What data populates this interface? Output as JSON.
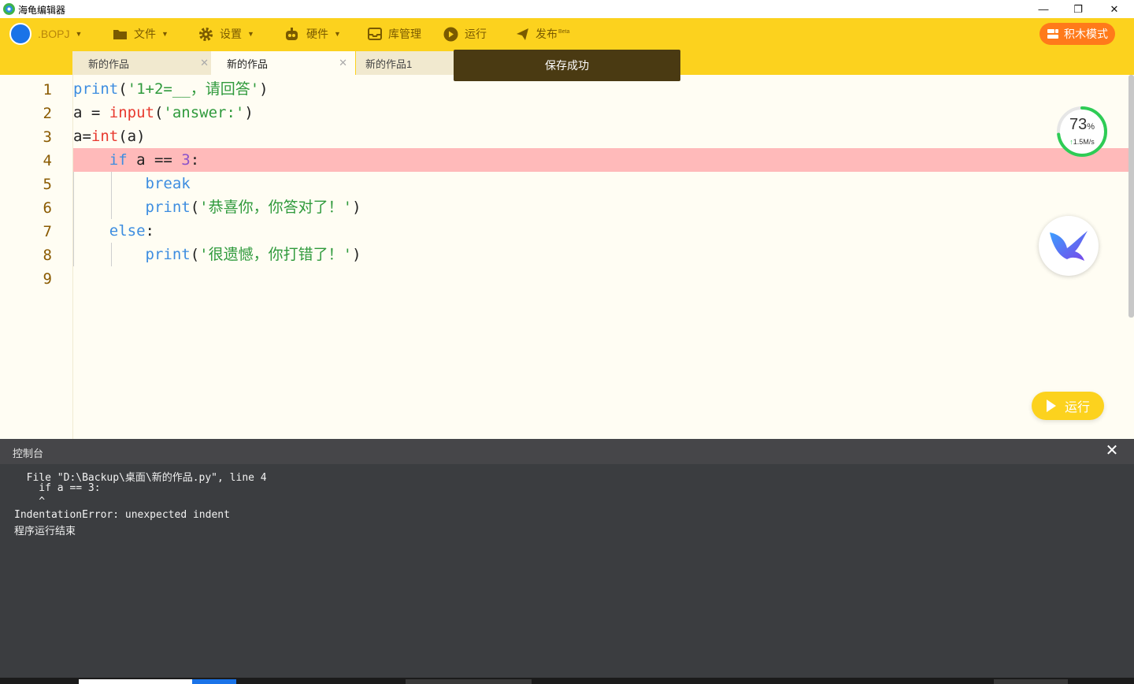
{
  "window": {
    "title": "海龟编辑器",
    "minimize_glyph": "—",
    "restore_glyph": "❐",
    "close_glyph": "✕"
  },
  "toolbar": {
    "user": ".BOPJ",
    "file": "文件",
    "settings": "设置",
    "hardware": "硬件",
    "library": "库管理",
    "run": "运行",
    "publish": "发布",
    "publish_badge": "Beta",
    "block_mode": "积木模式"
  },
  "tabs": [
    {
      "label": "新的作品",
      "active": false
    },
    {
      "label": "新的作品",
      "active": true
    },
    {
      "label": "新的作品1",
      "active": false
    }
  ],
  "tab_close_glyph": "✕",
  "toast": "保存成功",
  "editor": {
    "line_numbers": [
      "1",
      "2",
      "3",
      "4",
      "5",
      "6",
      "7",
      "8",
      "9"
    ],
    "highlighted_line": 4,
    "lines": [
      "print('1+2=__，请回答')",
      "a = input('answer:')",
      "a=int(a)",
      "    if a == 3:",
      "        break",
      "        print('恭喜你，你答对了！')",
      "    else:",
      "        print('很遗憾，你打错了！')",
      ""
    ]
  },
  "speed_widget": {
    "percent": "73",
    "percent_sign": "%",
    "speed": "1.5M/s",
    "ring_level": 0.73,
    "ring_color": "#2ecc55"
  },
  "run_button": "运行",
  "console": {
    "title": "控制台",
    "close_glyph": "✕",
    "lines": [
      "  File \"D:\\Backup\\桌面\\新的作品.py\", line 4",
      "    if a == 3:",
      "    ^",
      "IndentationError: unexpected indent",
      "程序运行结束"
    ]
  },
  "colors": {
    "toolbar_bg": "#fcd21e",
    "accent_orange": "#ff7a1a",
    "error_highlight": "#ffbaba",
    "console_bg": "#3b3d40"
  }
}
